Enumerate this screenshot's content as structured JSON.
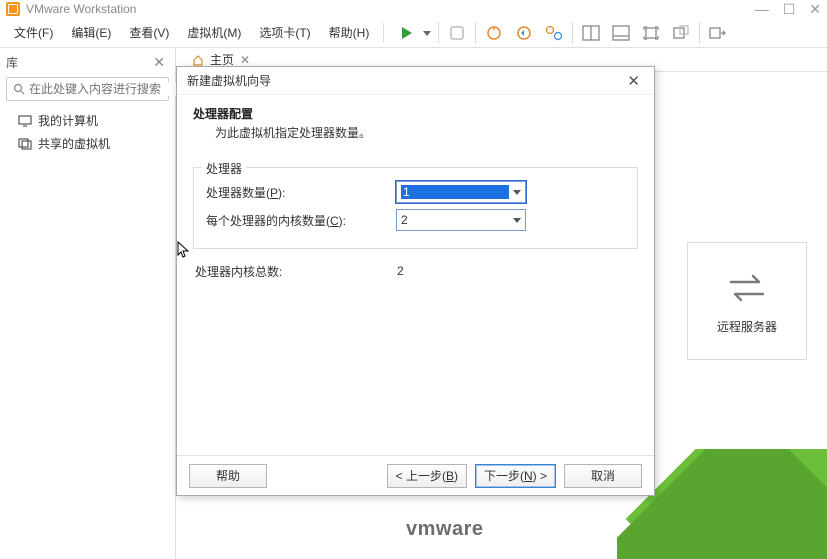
{
  "app": {
    "title": "VMware Workstation"
  },
  "windowControls": {
    "min": "—",
    "max": "☐",
    "close": "✕"
  },
  "menu": {
    "file": "文件(F)",
    "edit": "编辑(E)",
    "view": "查看(V)",
    "vm": "虚拟机(M)",
    "tabs": "选项卡(T)",
    "help": "帮助(H)"
  },
  "sidebar": {
    "title": "库",
    "close": "✕",
    "search_placeholder": "在此处键入内容进行搜索",
    "items": [
      {
        "label": "我的计算机"
      },
      {
        "label": "共享的虚拟机"
      }
    ]
  },
  "tabstrip": {
    "home_label": "主页",
    "tab_close": "✕"
  },
  "home": {
    "remote_label": "远程服务器",
    "logo": "vmware"
  },
  "dialog": {
    "title": "新建虚拟机向导",
    "close": "✕",
    "heading": "处理器配置",
    "sub": "为此虚拟机指定处理器数量。",
    "group": "处理器",
    "proc_count_label_pre": "处理器数量(",
    "proc_count_label_ul": "P",
    "proc_count_label_post": "):",
    "proc_count_value": "1",
    "cores_label_pre": "每个处理器的内核数量(",
    "cores_label_ul": "C",
    "cores_label_post": "):",
    "cores_value": "2",
    "total_label": "处理器内核总数:",
    "total_value": "2",
    "help": "帮助",
    "back_pre": "< 上一步(",
    "back_ul": "B",
    "back_post": ")",
    "next_pre": "下一步(",
    "next_ul": "N",
    "next_post": ") >",
    "cancel": "取消"
  }
}
